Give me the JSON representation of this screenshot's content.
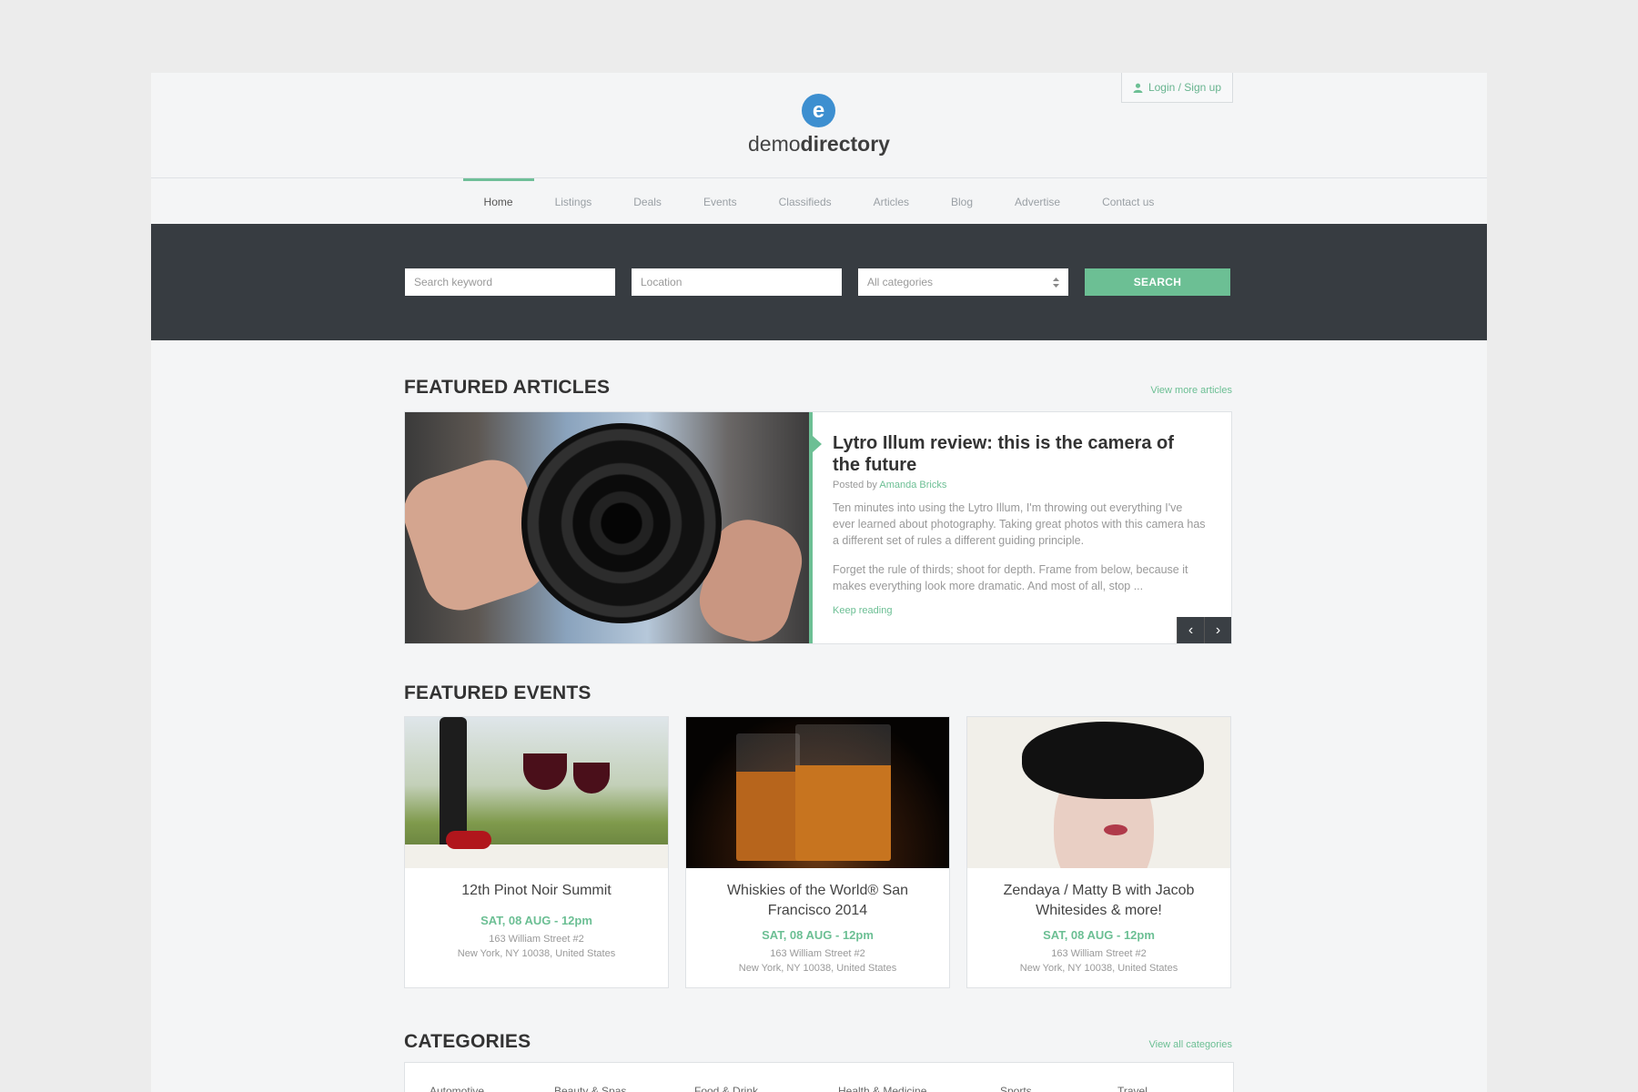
{
  "header": {
    "logo_letter": "e",
    "logo_light": "demo",
    "logo_bold": "directory",
    "login_label": "Login / Sign up"
  },
  "nav": {
    "items": [
      "Home",
      "Listings",
      "Deals",
      "Events",
      "Classifieds",
      "Articles",
      "Blog",
      "Advertise",
      "Contact us"
    ],
    "active": "Home"
  },
  "search": {
    "keyword_placeholder": "Search keyword",
    "location_placeholder": "Location",
    "category_selected": "All categories",
    "button_label": "SEARCH"
  },
  "featured_articles": {
    "title": "FEATURED ARTICLES",
    "view_more": "View more articles",
    "article": {
      "title": "Lytro Illum review: this is the camera of the future",
      "posted_by": "Posted by",
      "author": "Amanda Bricks",
      "paragraph1": "Ten minutes into using the Lytro Illum, I'm throwing out everything I've ever learned about photography. Taking great photos with this camera has a different set of rules  a different guiding principle.",
      "paragraph2": "Forget the rule of thirds; shoot for depth. Frame from below, because it makes everything look more dramatic. And most of all, stop ...",
      "read_more": "Keep reading"
    }
  },
  "featured_events": {
    "title": "FEATURED EVENTS",
    "events": [
      {
        "title": "12th Pinot Noir Summit",
        "date": "SAT, 08 AUG - 12pm",
        "address1": "163 William Street #2",
        "address2": "New York, NY 10038, United States"
      },
      {
        "title": "Whiskies of the World® San Francisco 2014",
        "date": "SAT, 08 AUG - 12pm",
        "address1": "163 William Street #2",
        "address2": "New York, NY 10038, United States"
      },
      {
        "title": "Zendaya / Matty B with Jacob Whitesides & more!",
        "date": "SAT, 08 AUG - 12pm",
        "address1": "163 William Street #2",
        "address2": "New York, NY 10038, United States"
      }
    ]
  },
  "categories": {
    "title": "CATEGORIES",
    "view_all": "View all categories",
    "items": [
      "Automotive",
      "Beauty & Spas",
      "Food & Drink",
      "Health & Medicine",
      "Sports",
      "Travel"
    ]
  },
  "colors": {
    "accent": "#6cbf94",
    "logo_blue": "#3d8fd0",
    "search_band": "#373c41"
  }
}
